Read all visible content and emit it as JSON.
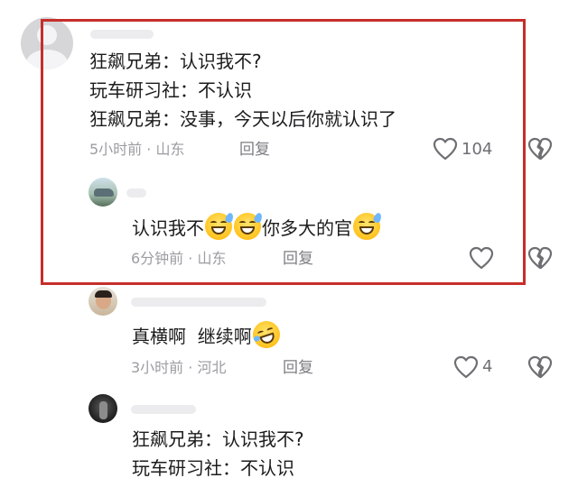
{
  "comments": [
    {
      "lines": [
        "狂飙兄弟：认识我不?",
        "玩车研习社：不认识",
        "狂飙兄弟：没事，今天以后你就认识了"
      ],
      "time": "5小时前",
      "location": "山东",
      "reply_label": "回复",
      "likes": "104"
    },
    {
      "text_a": "认识我不",
      "text_b": "你多大的官",
      "emojis": [
        "grinning-sweat-emoji",
        "grinning-sweat-emoji",
        "grinning-sweat-emoji"
      ],
      "time": "6分钟前",
      "location": "山东",
      "reply_label": "回复"
    },
    {
      "text": "真横啊  继续啊",
      "emojis": [
        "rolling-laughing-emoji"
      ],
      "time": "3小时前",
      "location": "河北",
      "reply_label": "回复",
      "likes": "4"
    },
    {
      "lines": [
        "狂飙兄弟：认识我不?",
        "玩车研习社：不认识"
      ]
    }
  ],
  "meta_separator": " · ",
  "icons": {
    "like": "heart-icon",
    "dislike": "broken-heart-icon"
  },
  "colors": {
    "highlight_border": "#c52f2a",
    "meta_text": "#9c9ca2",
    "icon_stroke": "#6e6e73"
  }
}
